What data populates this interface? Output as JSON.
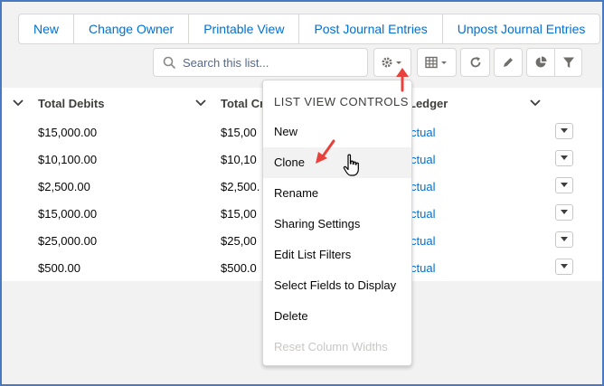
{
  "toolbar": {
    "buttons": [
      "New",
      "Change Owner",
      "Printable View",
      "Post Journal Entries",
      "Unpost Journal Entries"
    ]
  },
  "search": {
    "placeholder": "Search this list..."
  },
  "table": {
    "headers": [
      "Total Debits",
      "Total Cr",
      "Ledger"
    ],
    "rows": [
      {
        "debits": "$15,000.00",
        "credits": "$15,00",
        "ledger": "ctual"
      },
      {
        "debits": "$10,100.00",
        "credits": "$10,10",
        "ledger": "ctual"
      },
      {
        "debits": "$2,500.00",
        "credits": "$2,500.",
        "ledger": "ctual"
      },
      {
        "debits": "$15,000.00",
        "credits": "$15,00",
        "ledger": "ctual"
      },
      {
        "debits": "$25,000.00",
        "credits": "$25,00",
        "ledger": "ctual"
      },
      {
        "debits": "$500.00",
        "credits": "$500.0",
        "ledger": "ctual"
      }
    ]
  },
  "menu": {
    "header": "LIST VIEW CONTROLS",
    "items": [
      "New",
      "Clone",
      "Rename",
      "Sharing Settings",
      "Edit List Filters",
      "Select Fields to Display",
      "Delete",
      "Reset Column Widths"
    ]
  },
  "colors": {
    "accent": "#0070d2",
    "annotation": "#e8403a",
    "frame": "#4a79c4"
  }
}
